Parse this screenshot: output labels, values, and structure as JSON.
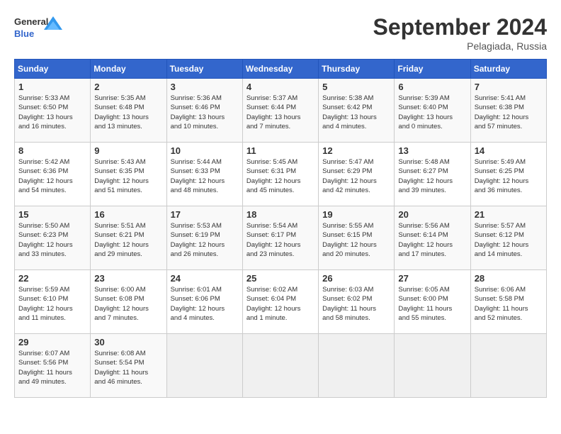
{
  "header": {
    "logo_line1": "General",
    "logo_line2": "Blue",
    "month": "September 2024",
    "location": "Pelagiada, Russia"
  },
  "weekdays": [
    "Sunday",
    "Monday",
    "Tuesday",
    "Wednesday",
    "Thursday",
    "Friday",
    "Saturday"
  ],
  "weeks": [
    [
      {
        "day": "1",
        "info": "Sunrise: 5:33 AM\nSunset: 6:50 PM\nDaylight: 13 hours\nand 16 minutes."
      },
      {
        "day": "2",
        "info": "Sunrise: 5:35 AM\nSunset: 6:48 PM\nDaylight: 13 hours\nand 13 minutes."
      },
      {
        "day": "3",
        "info": "Sunrise: 5:36 AM\nSunset: 6:46 PM\nDaylight: 13 hours\nand 10 minutes."
      },
      {
        "day": "4",
        "info": "Sunrise: 5:37 AM\nSunset: 6:44 PM\nDaylight: 13 hours\nand 7 minutes."
      },
      {
        "day": "5",
        "info": "Sunrise: 5:38 AM\nSunset: 6:42 PM\nDaylight: 13 hours\nand 4 minutes."
      },
      {
        "day": "6",
        "info": "Sunrise: 5:39 AM\nSunset: 6:40 PM\nDaylight: 13 hours\nand 0 minutes."
      },
      {
        "day": "7",
        "info": "Sunrise: 5:41 AM\nSunset: 6:38 PM\nDaylight: 12 hours\nand 57 minutes."
      }
    ],
    [
      {
        "day": "8",
        "info": "Sunrise: 5:42 AM\nSunset: 6:36 PM\nDaylight: 12 hours\nand 54 minutes."
      },
      {
        "day": "9",
        "info": "Sunrise: 5:43 AM\nSunset: 6:35 PM\nDaylight: 12 hours\nand 51 minutes."
      },
      {
        "day": "10",
        "info": "Sunrise: 5:44 AM\nSunset: 6:33 PM\nDaylight: 12 hours\nand 48 minutes."
      },
      {
        "day": "11",
        "info": "Sunrise: 5:45 AM\nSunset: 6:31 PM\nDaylight: 12 hours\nand 45 minutes."
      },
      {
        "day": "12",
        "info": "Sunrise: 5:47 AM\nSunset: 6:29 PM\nDaylight: 12 hours\nand 42 minutes."
      },
      {
        "day": "13",
        "info": "Sunrise: 5:48 AM\nSunset: 6:27 PM\nDaylight: 12 hours\nand 39 minutes."
      },
      {
        "day": "14",
        "info": "Sunrise: 5:49 AM\nSunset: 6:25 PM\nDaylight: 12 hours\nand 36 minutes."
      }
    ],
    [
      {
        "day": "15",
        "info": "Sunrise: 5:50 AM\nSunset: 6:23 PM\nDaylight: 12 hours\nand 33 minutes."
      },
      {
        "day": "16",
        "info": "Sunrise: 5:51 AM\nSunset: 6:21 PM\nDaylight: 12 hours\nand 29 minutes."
      },
      {
        "day": "17",
        "info": "Sunrise: 5:53 AM\nSunset: 6:19 PM\nDaylight: 12 hours\nand 26 minutes."
      },
      {
        "day": "18",
        "info": "Sunrise: 5:54 AM\nSunset: 6:17 PM\nDaylight: 12 hours\nand 23 minutes."
      },
      {
        "day": "19",
        "info": "Sunrise: 5:55 AM\nSunset: 6:15 PM\nDaylight: 12 hours\nand 20 minutes."
      },
      {
        "day": "20",
        "info": "Sunrise: 5:56 AM\nSunset: 6:14 PM\nDaylight: 12 hours\nand 17 minutes."
      },
      {
        "day": "21",
        "info": "Sunrise: 5:57 AM\nSunset: 6:12 PM\nDaylight: 12 hours\nand 14 minutes."
      }
    ],
    [
      {
        "day": "22",
        "info": "Sunrise: 5:59 AM\nSunset: 6:10 PM\nDaylight: 12 hours\nand 11 minutes."
      },
      {
        "day": "23",
        "info": "Sunrise: 6:00 AM\nSunset: 6:08 PM\nDaylight: 12 hours\nand 7 minutes."
      },
      {
        "day": "24",
        "info": "Sunrise: 6:01 AM\nSunset: 6:06 PM\nDaylight: 12 hours\nand 4 minutes."
      },
      {
        "day": "25",
        "info": "Sunrise: 6:02 AM\nSunset: 6:04 PM\nDaylight: 12 hours\nand 1 minute."
      },
      {
        "day": "26",
        "info": "Sunrise: 6:03 AM\nSunset: 6:02 PM\nDaylight: 11 hours\nand 58 minutes."
      },
      {
        "day": "27",
        "info": "Sunrise: 6:05 AM\nSunset: 6:00 PM\nDaylight: 11 hours\nand 55 minutes."
      },
      {
        "day": "28",
        "info": "Sunrise: 6:06 AM\nSunset: 5:58 PM\nDaylight: 11 hours\nand 52 minutes."
      }
    ],
    [
      {
        "day": "29",
        "info": "Sunrise: 6:07 AM\nSunset: 5:56 PM\nDaylight: 11 hours\nand 49 minutes."
      },
      {
        "day": "30",
        "info": "Sunrise: 6:08 AM\nSunset: 5:54 PM\nDaylight: 11 hours\nand 46 minutes."
      },
      {
        "day": "",
        "info": ""
      },
      {
        "day": "",
        "info": ""
      },
      {
        "day": "",
        "info": ""
      },
      {
        "day": "",
        "info": ""
      },
      {
        "day": "",
        "info": ""
      }
    ]
  ]
}
